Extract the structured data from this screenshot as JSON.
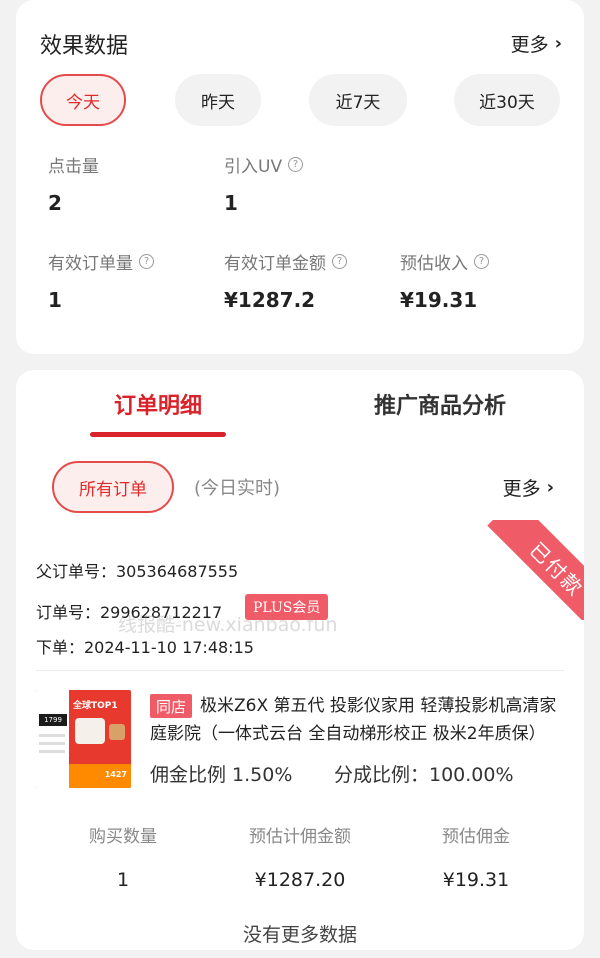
{
  "effect": {
    "title": "效果数据",
    "more_label": "更多",
    "periods": [
      "今天",
      "昨天",
      "近7天",
      "近30天"
    ],
    "stats": {
      "clicks": {
        "label": "点击量",
        "value": "2"
      },
      "uv": {
        "label": "引入UV",
        "value": "1"
      },
      "valid_orders": {
        "label": "有效订单量",
        "value": "1"
      },
      "valid_amount": {
        "label": "有效订单金额",
        "value": "¥1287.2"
      },
      "est_income": {
        "label": "预估收入",
        "value": "¥19.31"
      }
    }
  },
  "tabs": [
    "订单明细",
    "推广商品分析"
  ],
  "filter": {
    "all_orders_label": "所有订单",
    "realtime_note": "(今日实时)",
    "more_label": "更多"
  },
  "order": {
    "status": "已付款",
    "parent_order_line": "父订单号：305364687555",
    "order_no_line": "订单号：299628712217",
    "plus_badge": "PLUS会员",
    "time_line": "下单：2024-11-10 17:48:15",
    "watermark": "线报酷-new.xianbao.fun",
    "product": {
      "store_badge": "同店",
      "title": "极米Z6X 第五代 投影仪家用 轻薄投影机高清家庭影院（一体式云台 全自动梯形校正 极米2年质保）",
      "commission_rate": "佣金比例 1.50%",
      "share_rate": "分成比例：100.00%",
      "image_text": {
        "price": "1799",
        "top": "全球TOP1",
        "bottom": "1427"
      }
    },
    "columns": {
      "qty": {
        "label": "购买数量",
        "value": "1"
      },
      "est_amount": {
        "label": "预估计佣金额",
        "value": "¥1287.20"
      },
      "est_commission": {
        "label": "预估佣金",
        "value": "¥19.31"
      }
    }
  },
  "footer": {
    "no_more": "没有更多数据"
  },
  "colors": {
    "accent": "#d9232b",
    "badge": "#ef5b66",
    "pill_bg": "#f2f2f2"
  }
}
